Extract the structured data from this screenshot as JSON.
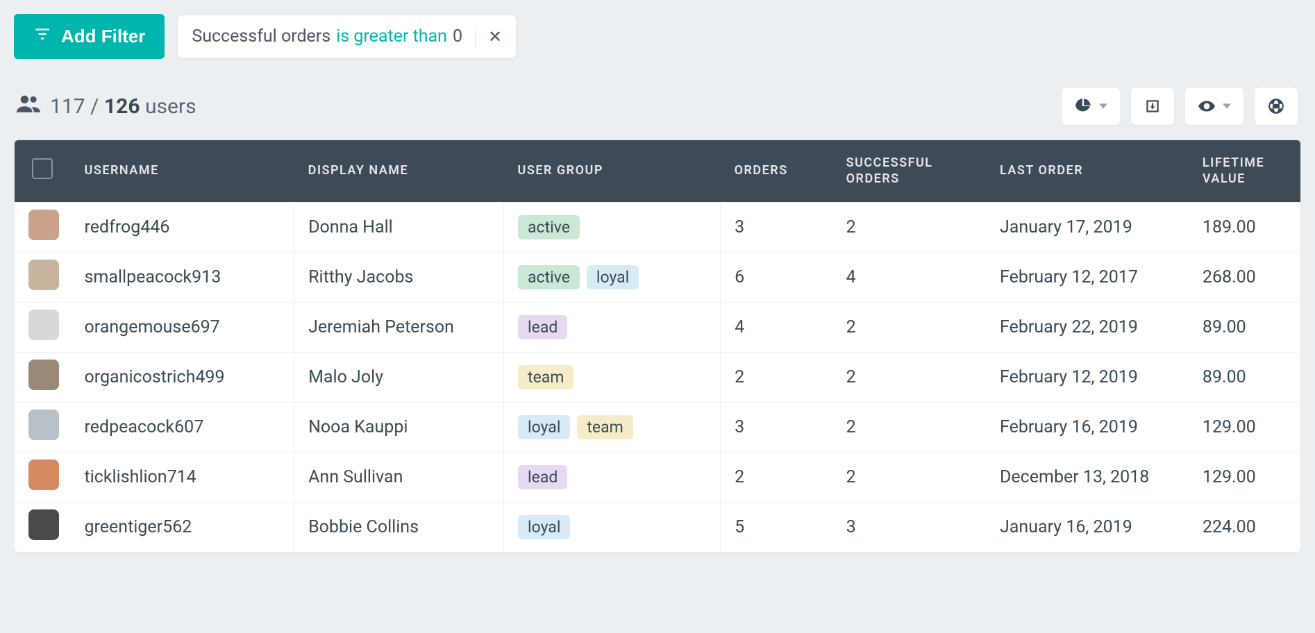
{
  "filters": {
    "add_label": "Add Filter",
    "chip": {
      "field": "Successful orders",
      "operator": "is greater than",
      "value": "0"
    }
  },
  "counts": {
    "shown": "117",
    "separator": "/",
    "total": "126",
    "label": "users"
  },
  "columns": {
    "username": "USERNAME",
    "display_name": "DISPLAY NAME",
    "user_group": "USER GROUP",
    "orders": "ORDERS",
    "successful_orders": "SUCCESSFUL ORDERS",
    "last_order": "LAST ORDER",
    "lifetime_value": "LIFETIME VALUE"
  },
  "tag_labels": {
    "active": "active",
    "loyal": "loyal",
    "lead": "lead",
    "team": "team"
  },
  "rows": [
    {
      "avatar_color": "#caa18a",
      "username": "redfrog446",
      "display_name": "Donna Hall",
      "groups": [
        "active"
      ],
      "orders": "3",
      "successful_orders": "2",
      "last_order": "January 17, 2019",
      "lifetime_value": "189.00"
    },
    {
      "avatar_color": "#c7b59d",
      "username": "smallpeacock913",
      "display_name": "Ritthy Jacobs",
      "groups": [
        "active",
        "loyal"
      ],
      "orders": "6",
      "successful_orders": "4",
      "last_order": "February 12, 2017",
      "lifetime_value": "268.00"
    },
    {
      "avatar_color": "#d6d8da",
      "username": "orangemouse697",
      "display_name": "Jeremiah Peterson",
      "groups": [
        "lead"
      ],
      "orders": "4",
      "successful_orders": "2",
      "last_order": "February 22, 2019",
      "lifetime_value": "89.00"
    },
    {
      "avatar_color": "#9b8977",
      "username": "organicostrich499",
      "display_name": "Malo Joly",
      "groups": [
        "team"
      ],
      "orders": "2",
      "successful_orders": "2",
      "last_order": "February 12, 2019",
      "lifetime_value": "89.00"
    },
    {
      "avatar_color": "#b9c1c8",
      "username": "redpeacock607",
      "display_name": "Nooa Kauppi",
      "groups": [
        "loyal",
        "team"
      ],
      "orders": "3",
      "successful_orders": "2",
      "last_order": "February 16, 2019",
      "lifetime_value": "129.00"
    },
    {
      "avatar_color": "#d48b62",
      "username": "ticklishlion714",
      "display_name": "Ann Sullivan",
      "groups": [
        "lead"
      ],
      "orders": "2",
      "successful_orders": "2",
      "last_order": "December 13, 2018",
      "lifetime_value": "129.00"
    },
    {
      "avatar_color": "#4a4a4a",
      "username": "greentiger562",
      "display_name": "Bobbie Collins",
      "groups": [
        "loyal"
      ],
      "orders": "5",
      "successful_orders": "3",
      "last_order": "January 16, 2019",
      "lifetime_value": "224.00"
    }
  ]
}
